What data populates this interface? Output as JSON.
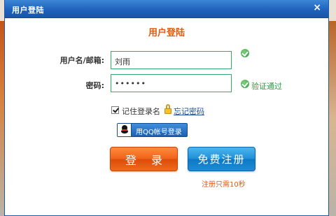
{
  "window": {
    "title": "用户登陆",
    "close_glyph": "×"
  },
  "form": {
    "heading": "用户登陆",
    "username_label": "用户名/邮箱:",
    "username_value": "刘雨",
    "password_label": "密码:",
    "password_value": "••••••",
    "verify_status": "验证通过",
    "remember_label": "记住登录名",
    "remember_checked": true,
    "forgot_link": "忘记密码",
    "qq_login_label": "用QQ帐号登录",
    "login_button": "登 录",
    "register_button": "免费注册",
    "register_hint": "注册只需10秒"
  },
  "icons": {
    "close": "close-icon",
    "valid": "check-circle-icon",
    "lock": "lock-icon",
    "qq": "qq-penguin-icon"
  },
  "colors": {
    "titlebar": "#1f63bd",
    "accent_orange": "#e25a0c",
    "success_green": "#2e9a3e",
    "field_border": "#35a86a",
    "link_blue": "#1d4f9c",
    "login_button": "#f0641a",
    "register_button": "#1f8fd7"
  }
}
